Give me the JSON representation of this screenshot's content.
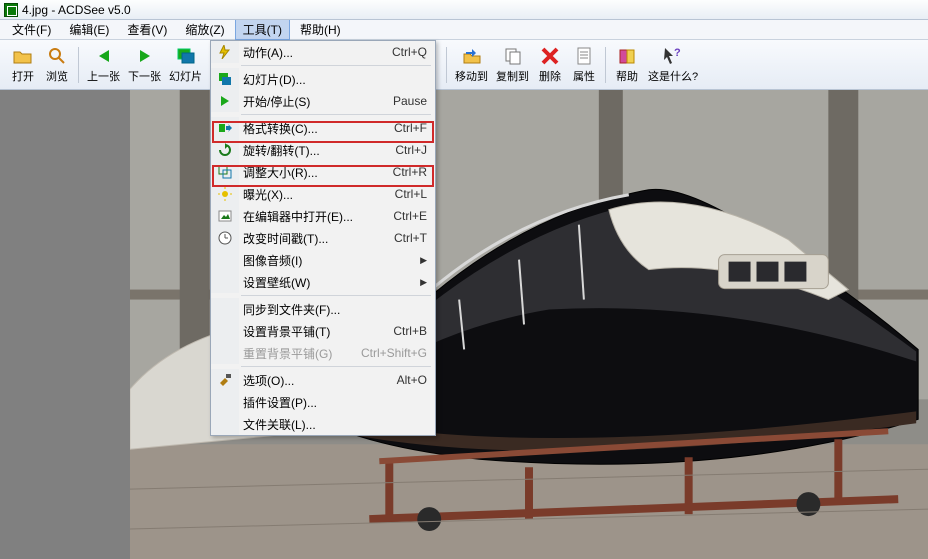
{
  "title": "4.jpg - ACDSee v5.0",
  "menubar": {
    "file": "文件(F)",
    "edit": "编辑(E)",
    "view": "查看(V)",
    "zoom": "缩放(Z)",
    "tools": "工具(T)",
    "help": "帮助(H)"
  },
  "toolbar": {
    "open": "打开",
    "browse": "浏览",
    "prev": "上一张",
    "next": "下一张",
    "slide": "幻灯片",
    "moveTo": "移动到",
    "copyTo": "复制到",
    "delete": "删除",
    "props": "属性",
    "helpBtn": "帮助",
    "whatsThis": "这是什么?"
  },
  "dropdown": {
    "actions": {
      "l": "动作(A)...",
      "s": "Ctrl+Q"
    },
    "slideshow": {
      "l": "幻灯片(D)..."
    },
    "startStop": {
      "l": "开始/停止(S)",
      "s": "Pause"
    },
    "formatConvert": {
      "l": "格式转换(C)...",
      "s": "Ctrl+F"
    },
    "rotateFlip": {
      "l": "旋转/翻转(T)...",
      "s": "Ctrl+J"
    },
    "resize": {
      "l": "调整大小(R)...",
      "s": "Ctrl+R"
    },
    "exposure": {
      "l": "曝光(X)...",
      "s": "Ctrl+L"
    },
    "openInEditor": {
      "l": "在编辑器中打开(E)...",
      "s": "Ctrl+E"
    },
    "changeTimestamp": {
      "l": "改变时间戳(T)...",
      "s": "Ctrl+T"
    },
    "imageAudio": {
      "l": "图像音频(I)"
    },
    "setWallpaper": {
      "l": "设置壁纸(W)"
    },
    "syncToFolder": {
      "l": "同步到文件夹(F)..."
    },
    "setBgTile": {
      "l": "设置背景平铺(T)",
      "s": "Ctrl+B"
    },
    "resetBgTile": {
      "l": "重置背景平铺(G)",
      "s": "Ctrl+Shift+G"
    },
    "options": {
      "l": "选项(O)...",
      "s": "Alt+O"
    },
    "pluginSettings": {
      "l": "插件设置(P)..."
    },
    "fileAssoc": {
      "l": "文件关联(L)..."
    }
  }
}
